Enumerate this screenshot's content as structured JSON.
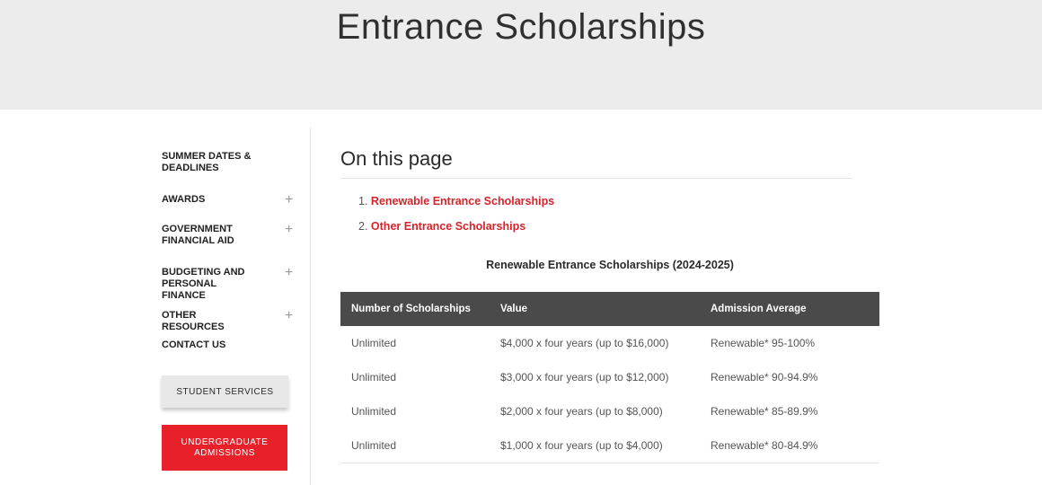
{
  "page": {
    "title": "Entrance Scholarships"
  },
  "sidebar": {
    "items": [
      {
        "label": "SUMMER DATES & DEADLINES",
        "expandable": false
      },
      {
        "label": "AWARDS",
        "expandable": true
      },
      {
        "label": "GOVERNMENT FINANCIAL AID",
        "expandable": true
      },
      {
        "label": "BUDGETING AND PERSONAL FINANCE",
        "expandable": true
      },
      {
        "label": "OTHER RESOURCES",
        "expandable": true
      },
      {
        "label": "CONTACT US",
        "expandable": false
      }
    ],
    "expand_glyph": "+",
    "student_services_label": "STUDENT SERVICES",
    "undergraduate_admissions_label": "UNDERGRADUATE ADMISSIONS"
  },
  "on_this_page": {
    "heading": "On this page",
    "links": [
      {
        "number": "1.",
        "label": "Renewable Entrance Scholarships"
      },
      {
        "number": "2.",
        "label": "Other Entrance Scholarships"
      }
    ]
  },
  "table": {
    "caption": "Renewable Entrance Scholarships (2024-2025)",
    "headers": [
      "Number of Scholarships",
      "Value",
      "Admission Average"
    ],
    "rows": [
      [
        "Unlimited",
        "$4,000 x four years (up to $16,000)",
        "Renewable* 95-100%"
      ],
      [
        "Unlimited",
        "$3,000 x four years (up to $12,000)",
        "Renewable* 90-94.9%"
      ],
      [
        "Unlimited",
        "$2,000 x four years (up to $8,000)",
        "Renewable* 85-89.9%"
      ],
      [
        "Unlimited",
        "$1,000 x four years (up to $4,000)",
        "Renewable* 80-84.9%"
      ]
    ]
  },
  "colors": {
    "accent": "#e8202a",
    "link": "#d7242b",
    "header_bg": "#ececec",
    "table_header_bg": "#4a4a4a"
  }
}
